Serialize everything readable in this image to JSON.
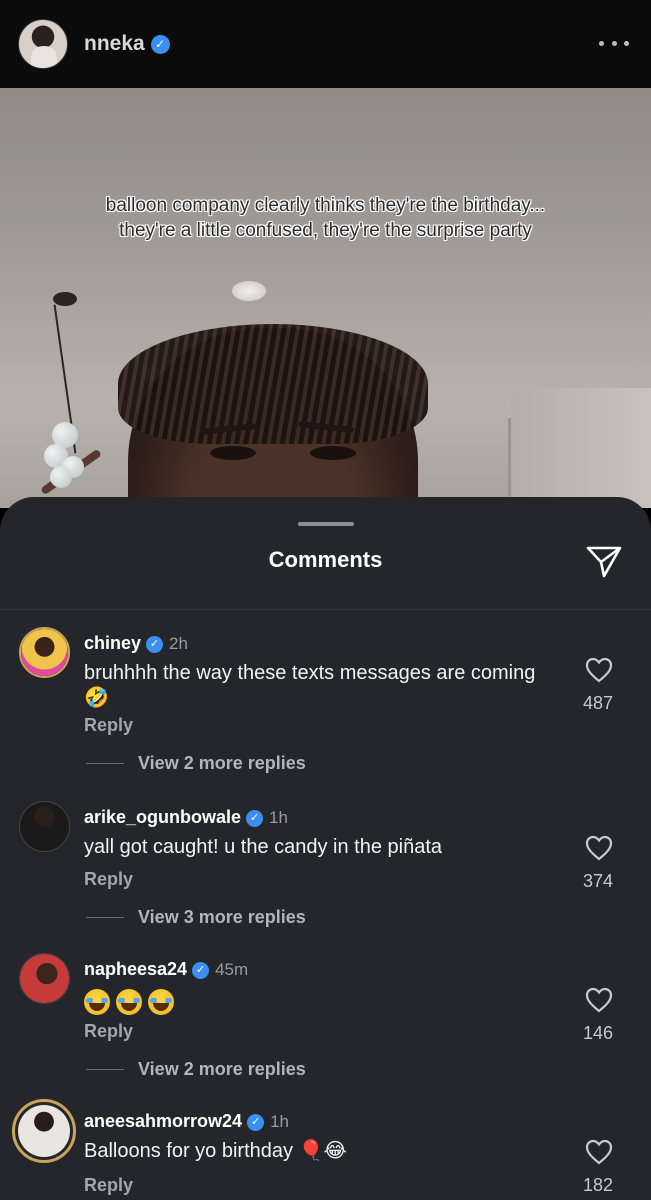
{
  "header": {
    "username": "nneka",
    "verified": true
  },
  "video": {
    "caption_line1": "balloon company clearly thinks they're the birthday...",
    "caption_line2": "they're a little confused, they're the surprise party"
  },
  "sheet": {
    "title": "Comments"
  },
  "comments": [
    {
      "username": "chiney",
      "verified": true,
      "time": "2h",
      "text": "bruhhhh the way these texts messages are coming 🤣",
      "reply_label": "Reply",
      "likes": "487",
      "view_more": "View 2 more replies"
    },
    {
      "username": "arike_ogunbowale",
      "verified": true,
      "time": "1h",
      "text": "yall got caught! u the candy in the piñata",
      "reply_label": "Reply",
      "likes": "374",
      "view_more": "View 3 more replies"
    },
    {
      "username": "napheesa24",
      "verified": true,
      "time": "45m",
      "text": "😭😭😭",
      "reply_label": "Reply",
      "likes": "146",
      "view_more": "View 2 more replies"
    },
    {
      "username": "aneesahmorrow24",
      "verified": true,
      "time": "1h",
      "text": "Balloons for yo birthday 🎈😂",
      "reply_label": "Reply",
      "likes": "182"
    }
  ],
  "colors": {
    "sheet_bg": "#25262b",
    "verified_blue": "#3b8ff0",
    "secondary_text": "#a5a6aa"
  },
  "icons": {
    "more": "more-horizontal-icon",
    "share": "send-paper-plane-icon",
    "like": "heart-outline-icon",
    "verified": "verified-badge-icon"
  }
}
